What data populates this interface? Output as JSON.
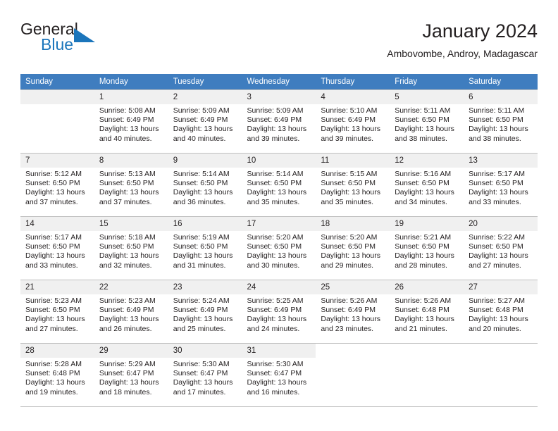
{
  "brand": {
    "name_part1": "General",
    "name_part2": "Blue",
    "accent_color": "#1b75bb",
    "triangle_icon": "triangle-right-icon"
  },
  "header": {
    "title": "January 2024",
    "subtitle": "Ambovombe, Androy, Madagascar"
  },
  "colors": {
    "header_row": "#3f7dbf",
    "day_number_band": "#f0f0f0",
    "grid_line": "#bfbfbf",
    "text": "#231f20"
  },
  "weekday_headers": [
    "Sunday",
    "Monday",
    "Tuesday",
    "Wednesday",
    "Thursday",
    "Friday",
    "Saturday"
  ],
  "weeks": [
    [
      {
        "day": "",
        "sunrise": "",
        "sunset": "",
        "daylight_line1": "",
        "daylight_line2": ""
      },
      {
        "day": "1",
        "sunrise": "Sunrise: 5:08 AM",
        "sunset": "Sunset: 6:49 PM",
        "daylight_line1": "Daylight: 13 hours",
        "daylight_line2": "and 40 minutes."
      },
      {
        "day": "2",
        "sunrise": "Sunrise: 5:09 AM",
        "sunset": "Sunset: 6:49 PM",
        "daylight_line1": "Daylight: 13 hours",
        "daylight_line2": "and 40 minutes."
      },
      {
        "day": "3",
        "sunrise": "Sunrise: 5:09 AM",
        "sunset": "Sunset: 6:49 PM",
        "daylight_line1": "Daylight: 13 hours",
        "daylight_line2": "and 39 minutes."
      },
      {
        "day": "4",
        "sunrise": "Sunrise: 5:10 AM",
        "sunset": "Sunset: 6:49 PM",
        "daylight_line1": "Daylight: 13 hours",
        "daylight_line2": "and 39 minutes."
      },
      {
        "day": "5",
        "sunrise": "Sunrise: 5:11 AM",
        "sunset": "Sunset: 6:50 PM",
        "daylight_line1": "Daylight: 13 hours",
        "daylight_line2": "and 38 minutes."
      },
      {
        "day": "6",
        "sunrise": "Sunrise: 5:11 AM",
        "sunset": "Sunset: 6:50 PM",
        "daylight_line1": "Daylight: 13 hours",
        "daylight_line2": "and 38 minutes."
      }
    ],
    [
      {
        "day": "7",
        "sunrise": "Sunrise: 5:12 AM",
        "sunset": "Sunset: 6:50 PM",
        "daylight_line1": "Daylight: 13 hours",
        "daylight_line2": "and 37 minutes."
      },
      {
        "day": "8",
        "sunrise": "Sunrise: 5:13 AM",
        "sunset": "Sunset: 6:50 PM",
        "daylight_line1": "Daylight: 13 hours",
        "daylight_line2": "and 37 minutes."
      },
      {
        "day": "9",
        "sunrise": "Sunrise: 5:14 AM",
        "sunset": "Sunset: 6:50 PM",
        "daylight_line1": "Daylight: 13 hours",
        "daylight_line2": "and 36 minutes."
      },
      {
        "day": "10",
        "sunrise": "Sunrise: 5:14 AM",
        "sunset": "Sunset: 6:50 PM",
        "daylight_line1": "Daylight: 13 hours",
        "daylight_line2": "and 35 minutes."
      },
      {
        "day": "11",
        "sunrise": "Sunrise: 5:15 AM",
        "sunset": "Sunset: 6:50 PM",
        "daylight_line1": "Daylight: 13 hours",
        "daylight_line2": "and 35 minutes."
      },
      {
        "day": "12",
        "sunrise": "Sunrise: 5:16 AM",
        "sunset": "Sunset: 6:50 PM",
        "daylight_line1": "Daylight: 13 hours",
        "daylight_line2": "and 34 minutes."
      },
      {
        "day": "13",
        "sunrise": "Sunrise: 5:17 AM",
        "sunset": "Sunset: 6:50 PM",
        "daylight_line1": "Daylight: 13 hours",
        "daylight_line2": "and 33 minutes."
      }
    ],
    [
      {
        "day": "14",
        "sunrise": "Sunrise: 5:17 AM",
        "sunset": "Sunset: 6:50 PM",
        "daylight_line1": "Daylight: 13 hours",
        "daylight_line2": "and 33 minutes."
      },
      {
        "day": "15",
        "sunrise": "Sunrise: 5:18 AM",
        "sunset": "Sunset: 6:50 PM",
        "daylight_line1": "Daylight: 13 hours",
        "daylight_line2": "and 32 minutes."
      },
      {
        "day": "16",
        "sunrise": "Sunrise: 5:19 AM",
        "sunset": "Sunset: 6:50 PM",
        "daylight_line1": "Daylight: 13 hours",
        "daylight_line2": "and 31 minutes."
      },
      {
        "day": "17",
        "sunrise": "Sunrise: 5:20 AM",
        "sunset": "Sunset: 6:50 PM",
        "daylight_line1": "Daylight: 13 hours",
        "daylight_line2": "and 30 minutes."
      },
      {
        "day": "18",
        "sunrise": "Sunrise: 5:20 AM",
        "sunset": "Sunset: 6:50 PM",
        "daylight_line1": "Daylight: 13 hours",
        "daylight_line2": "and 29 minutes."
      },
      {
        "day": "19",
        "sunrise": "Sunrise: 5:21 AM",
        "sunset": "Sunset: 6:50 PM",
        "daylight_line1": "Daylight: 13 hours",
        "daylight_line2": "and 28 minutes."
      },
      {
        "day": "20",
        "sunrise": "Sunrise: 5:22 AM",
        "sunset": "Sunset: 6:50 PM",
        "daylight_line1": "Daylight: 13 hours",
        "daylight_line2": "and 27 minutes."
      }
    ],
    [
      {
        "day": "21",
        "sunrise": "Sunrise: 5:23 AM",
        "sunset": "Sunset: 6:50 PM",
        "daylight_line1": "Daylight: 13 hours",
        "daylight_line2": "and 27 minutes."
      },
      {
        "day": "22",
        "sunrise": "Sunrise: 5:23 AM",
        "sunset": "Sunset: 6:49 PM",
        "daylight_line1": "Daylight: 13 hours",
        "daylight_line2": "and 26 minutes."
      },
      {
        "day": "23",
        "sunrise": "Sunrise: 5:24 AM",
        "sunset": "Sunset: 6:49 PM",
        "daylight_line1": "Daylight: 13 hours",
        "daylight_line2": "and 25 minutes."
      },
      {
        "day": "24",
        "sunrise": "Sunrise: 5:25 AM",
        "sunset": "Sunset: 6:49 PM",
        "daylight_line1": "Daylight: 13 hours",
        "daylight_line2": "and 24 minutes."
      },
      {
        "day": "25",
        "sunrise": "Sunrise: 5:26 AM",
        "sunset": "Sunset: 6:49 PM",
        "daylight_line1": "Daylight: 13 hours",
        "daylight_line2": "and 23 minutes."
      },
      {
        "day": "26",
        "sunrise": "Sunrise: 5:26 AM",
        "sunset": "Sunset: 6:48 PM",
        "daylight_line1": "Daylight: 13 hours",
        "daylight_line2": "and 21 minutes."
      },
      {
        "day": "27",
        "sunrise": "Sunrise: 5:27 AM",
        "sunset": "Sunset: 6:48 PM",
        "daylight_line1": "Daylight: 13 hours",
        "daylight_line2": "and 20 minutes."
      }
    ],
    [
      {
        "day": "28",
        "sunrise": "Sunrise: 5:28 AM",
        "sunset": "Sunset: 6:48 PM",
        "daylight_line1": "Daylight: 13 hours",
        "daylight_line2": "and 19 minutes."
      },
      {
        "day": "29",
        "sunrise": "Sunrise: 5:29 AM",
        "sunset": "Sunset: 6:47 PM",
        "daylight_line1": "Daylight: 13 hours",
        "daylight_line2": "and 18 minutes."
      },
      {
        "day": "30",
        "sunrise": "Sunrise: 5:30 AM",
        "sunset": "Sunset: 6:47 PM",
        "daylight_line1": "Daylight: 13 hours",
        "daylight_line2": "and 17 minutes."
      },
      {
        "day": "31",
        "sunrise": "Sunrise: 5:30 AM",
        "sunset": "Sunset: 6:47 PM",
        "daylight_line1": "Daylight: 13 hours",
        "daylight_line2": "and 16 minutes."
      },
      {
        "day": "",
        "sunrise": "",
        "sunset": "",
        "daylight_line1": "",
        "daylight_line2": ""
      },
      {
        "day": "",
        "sunrise": "",
        "sunset": "",
        "daylight_line1": "",
        "daylight_line2": ""
      },
      {
        "day": "",
        "sunrise": "",
        "sunset": "",
        "daylight_line1": "",
        "daylight_line2": ""
      }
    ]
  ]
}
